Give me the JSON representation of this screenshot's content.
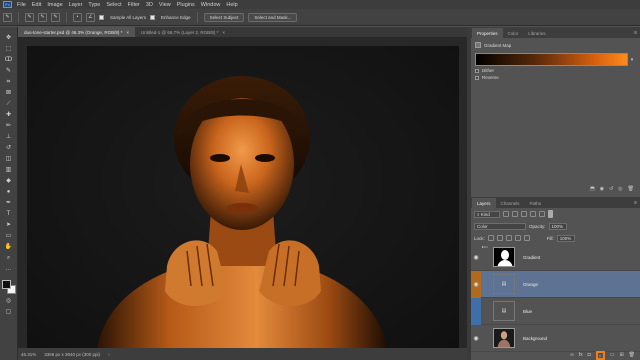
{
  "menu": {
    "logo": "Ps",
    "items": [
      "File",
      "Edit",
      "Image",
      "Layer",
      "Type",
      "Select",
      "Filter",
      "3D",
      "View",
      "Plugins",
      "Window",
      "Help"
    ]
  },
  "options": {
    "sample_all_layers": "Sample All Layers",
    "enhance_edge": "Enhance Edge",
    "select_subject": "Select Subject",
    "select_and_mask": "Select and Mask..."
  },
  "tabs": {
    "doc1": "duo-tone-starter.psd @ 46.3% (Orange, RGB/8) *",
    "doc2": "Untitled-1 @ 66.7% (Layer 2, RGB/8) *",
    "close": "×"
  },
  "status": {
    "zoom": "46.31%",
    "dims": "3366 px x 3840 px (300 ppi)"
  },
  "properties": {
    "tabs": [
      "Properties",
      "Color",
      "Libraries"
    ],
    "title": "Gradient Map",
    "dither": "Dither",
    "reverse": "Reverse",
    "gradient_colors": [
      "#000000",
      "#ff8a1f"
    ]
  },
  "layers": {
    "tabs": [
      "Layers",
      "Channels",
      "Paths"
    ],
    "kind": "Kind",
    "blend_mode": "Color",
    "opacity_label": "Opacity:",
    "opacity": "100%",
    "lock_label": "Lock:",
    "fill_label": "Fill:",
    "fill": "100%",
    "items": [
      {
        "name": "Gradient",
        "visible": true,
        "type": "group-mask"
      },
      {
        "name": "Orange",
        "visible": true,
        "type": "adjustment",
        "tag": "#b06a1d",
        "selected": true
      },
      {
        "name": "Blue",
        "visible": false,
        "type": "adjustment",
        "tag": "#3e6fa8"
      },
      {
        "name": "Background",
        "visible": true,
        "type": "image"
      }
    ]
  },
  "icons": {
    "visibility": "eye-icon",
    "menu": "panel-menu-icon"
  }
}
